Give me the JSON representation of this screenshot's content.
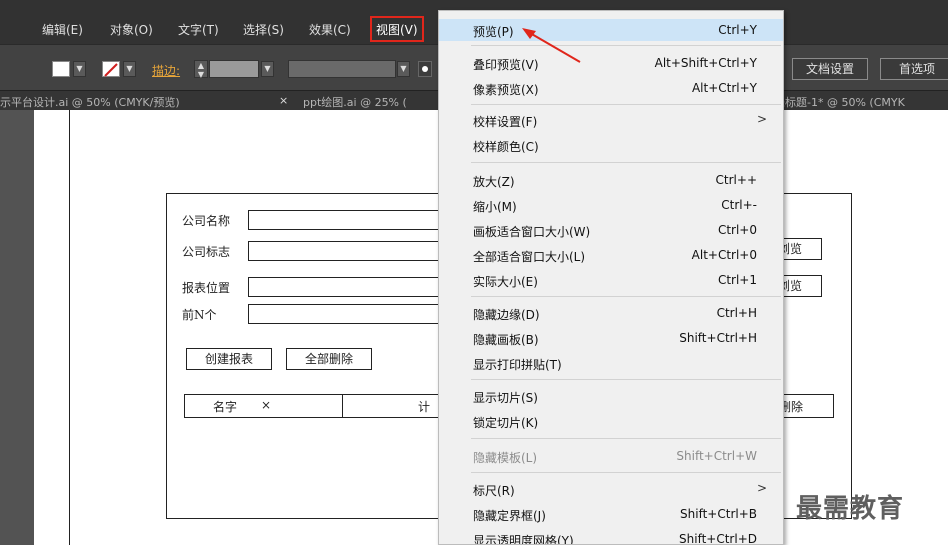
{
  "menubar": {
    "items": [
      "编辑(E)",
      "对象(O)",
      "文字(T)",
      "选择(S)",
      "效果(C)",
      "视图(V)"
    ]
  },
  "controlbar": {
    "stroke_label": "描边:",
    "doc_setup_button": "文档设置",
    "prefs_button": "首选项"
  },
  "tabs": [
    "示平台设计.ai @ 50% (CMYK/预览)",
    "×",
    "ppt绘图.ai @ 25% (",
    "未标题-1* @ 50% (CMYK"
  ],
  "form": {
    "labels": [
      "公司名称",
      "公司标志",
      "报表位置",
      "前N个"
    ],
    "browse1": "浏览",
    "browse2": "浏览",
    "create_button": "创建报表",
    "delete_all_button": "全部删除",
    "col_name": "名字",
    "col_close": "×",
    "col_calc": "计",
    "col_delete": "删除"
  },
  "menu": {
    "items": [
      {
        "label": "预览(P)",
        "shortcut": "Ctrl+Y"
      },
      {
        "label": "叠印预览(V)",
        "shortcut": "Alt+Shift+Ctrl+Y"
      },
      {
        "label": "像素预览(X)",
        "shortcut": "Alt+Ctrl+Y"
      },
      {
        "label": "校样设置(F)",
        "shortcut": ">"
      },
      {
        "label": "校样颜色(C)",
        "shortcut": ""
      },
      {
        "label": "放大(Z)",
        "shortcut": "Ctrl++"
      },
      {
        "label": "缩小(M)",
        "shortcut": "Ctrl+-"
      },
      {
        "label": "画板适合窗口大小(W)",
        "shortcut": "Ctrl+0"
      },
      {
        "label": "全部适合窗口大小(L)",
        "shortcut": "Alt+Ctrl+0"
      },
      {
        "label": "实际大小(E)",
        "shortcut": "Ctrl+1"
      },
      {
        "label": "隐藏边缘(D)",
        "shortcut": "Ctrl+H"
      },
      {
        "label": "隐藏画板(B)",
        "shortcut": "Shift+Ctrl+H"
      },
      {
        "label": "显示打印拼贴(T)",
        "shortcut": ""
      },
      {
        "label": "显示切片(S)",
        "shortcut": ""
      },
      {
        "label": "锁定切片(K)",
        "shortcut": ""
      },
      {
        "label": "隐藏模板(L)",
        "shortcut": "Shift+Ctrl+W"
      },
      {
        "label": "标尺(R)",
        "shortcut": ">"
      },
      {
        "label": "隐藏定界框(J)",
        "shortcut": "Shift+Ctrl+B"
      },
      {
        "label": "显示透明度网格(Y)",
        "shortcut": "Shift+Ctrl+D"
      }
    ]
  },
  "watermark": "最需教育",
  "colors": {
    "accent_red": "#e0261b",
    "menu_highlight": "#cde4f7",
    "stroke_orange": "#e8a63a"
  }
}
